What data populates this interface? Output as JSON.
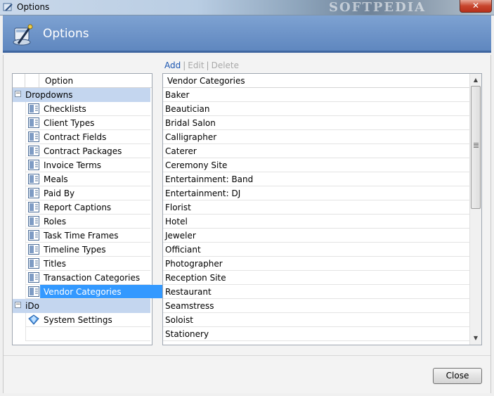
{
  "window": {
    "title": "Options",
    "watermark": "SOFTPEDIA",
    "close_glyph": "✕"
  },
  "header": {
    "title": "Options",
    "icon": "options-wand-icon"
  },
  "toolbar": {
    "add": "Add",
    "edit": "Edit",
    "delete": "Delete",
    "separator": "|"
  },
  "left_panel": {
    "column_header": "Option",
    "groups": [
      {
        "label": "Dropdowns",
        "expanded_glyph": "−",
        "items": [
          {
            "label": "Checklists",
            "icon": "list-icon"
          },
          {
            "label": "Client Types",
            "icon": "list-icon"
          },
          {
            "label": "Contract Fields",
            "icon": "list-icon"
          },
          {
            "label": "Contract Packages",
            "icon": "list-icon"
          },
          {
            "label": "Invoice Terms",
            "icon": "list-icon"
          },
          {
            "label": "Meals",
            "icon": "list-icon"
          },
          {
            "label": "Paid By",
            "icon": "list-icon"
          },
          {
            "label": "Report Captions",
            "icon": "list-icon"
          },
          {
            "label": "Roles",
            "icon": "list-icon"
          },
          {
            "label": "Task Time Frames",
            "icon": "list-icon"
          },
          {
            "label": "Timeline Types",
            "icon": "list-icon"
          },
          {
            "label": "Titles",
            "icon": "list-icon"
          },
          {
            "label": "Transaction Categories",
            "icon": "list-icon"
          },
          {
            "label": "Vendor Categories",
            "icon": "list-icon",
            "selected": true
          }
        ]
      },
      {
        "label": "iDo",
        "expanded_glyph": "−",
        "items": [
          {
            "label": "System Settings",
            "icon": "diamond-icon"
          }
        ]
      }
    ]
  },
  "right_panel": {
    "column_header": "Vendor Categories",
    "rows": [
      "Baker",
      "Beautician",
      "Bridal Salon",
      "Calligrapher",
      "Caterer",
      "Ceremony Site",
      "Entertainment: Band",
      "Entertainment: DJ",
      "Florist",
      "Hotel",
      "Jeweler",
      "Officiant",
      "Photographer",
      "Reception Site",
      "Restaurant",
      "Seamstress",
      "Soloist",
      "Stationery"
    ],
    "scroll_up_glyph": "▲",
    "scroll_down_glyph": "▼"
  },
  "footer": {
    "close_label": "Close"
  },
  "colors": {
    "header_blue": "#5f87bf",
    "selection": "#3399ff",
    "group_row": "#c4d6ef",
    "link": "#1a55b0"
  }
}
